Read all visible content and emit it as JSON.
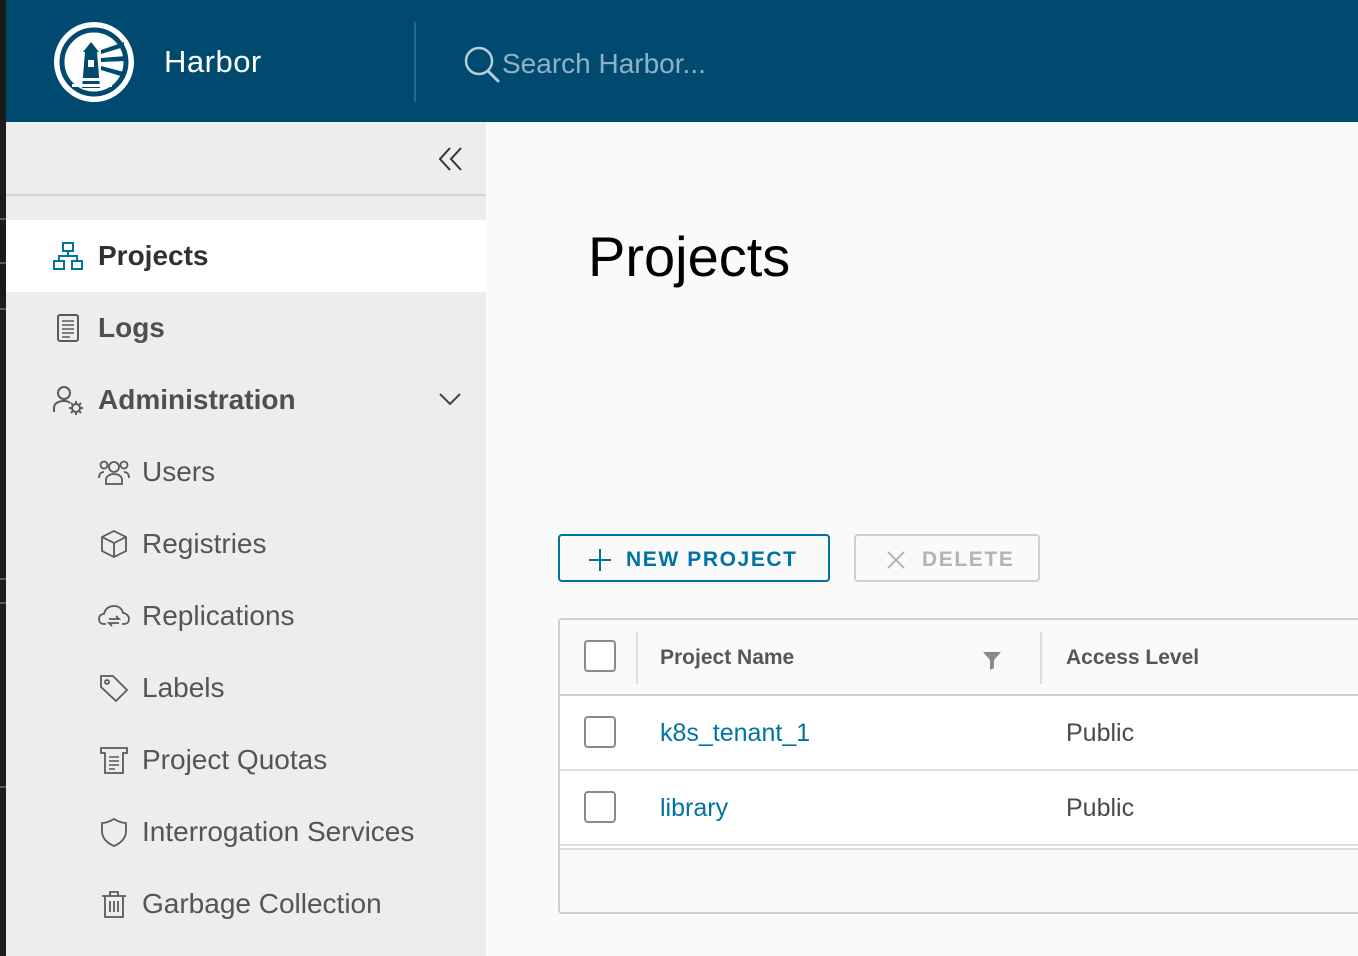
{
  "header": {
    "brand": "Harbor",
    "search_placeholder": "Search Harbor..."
  },
  "sidebar": {
    "items": [
      {
        "label": "Projects",
        "icon": "organization-icon",
        "active": true
      },
      {
        "label": "Logs",
        "icon": "logs-icon"
      },
      {
        "label": "Administration",
        "icon": "user-settings-icon",
        "expanded": true
      },
      {
        "label": "Users",
        "icon": "users-icon"
      },
      {
        "label": "Registries",
        "icon": "box-icon"
      },
      {
        "label": "Replications",
        "icon": "cloud-sync-icon"
      },
      {
        "label": "Labels",
        "icon": "tag-icon"
      },
      {
        "label": "Project Quotas",
        "icon": "quota-icon"
      },
      {
        "label": "Interrogation Services",
        "icon": "shield-icon"
      },
      {
        "label": "Garbage Collection",
        "icon": "trash-icon"
      }
    ]
  },
  "main": {
    "title": "Projects",
    "toolbar": {
      "new_project_label": "NEW PROJECT",
      "delete_label": "DELETE"
    },
    "grid": {
      "columns": [
        "Project Name",
        "Access Level"
      ],
      "rows": [
        {
          "name": "k8s_tenant_1",
          "access": "Public"
        },
        {
          "name": "library",
          "access": "Public"
        }
      ]
    }
  },
  "colors": {
    "header_bg": "#004a70",
    "accent": "#0072a3",
    "sidebar_bg": "#ededed"
  }
}
